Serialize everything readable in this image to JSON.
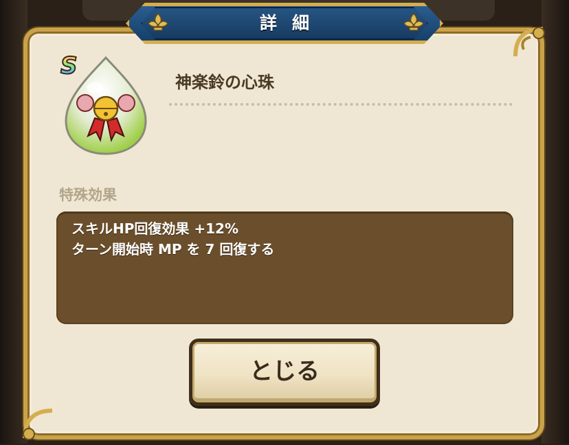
{
  "dialog": {
    "title": "詳細",
    "item_name": "神楽鈴の心珠",
    "rank": "S",
    "effect_label": "特殊効果",
    "effects": [
      "スキルHP回復効果 +12%",
      "ターン開始時 MP を 7 回復する"
    ],
    "close_label": "とじる"
  },
  "colors": {
    "panel": "#efe7d3",
    "frame_gold": "#c9a24a",
    "banner_blue": "#1f4d7a",
    "effect_box": "#6b4e2b"
  },
  "icons": {
    "item": "kagura-bell-orb-icon",
    "ornament": "fleur-de-lis-icon"
  }
}
